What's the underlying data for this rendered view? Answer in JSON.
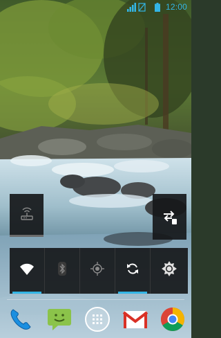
{
  "status_bar": {
    "time": "12:00",
    "accent_color": "#33b5e5",
    "icons": [
      "signal-icon",
      "battery-icon"
    ]
  },
  "widgets": {
    "left_tile": {
      "icon": "wifi-hotspot-icon",
      "active": false
    },
    "right_tile": {
      "icon": "data-transfer-icon",
      "active": false
    }
  },
  "power_control": {
    "toggles": [
      {
        "icon": "wifi-icon",
        "active": true
      },
      {
        "icon": "bluetooth-icon",
        "active": false
      },
      {
        "icon": "gps-icon",
        "active": false
      },
      {
        "icon": "sync-icon",
        "active": true
      },
      {
        "icon": "brightness-icon",
        "active": false
      }
    ],
    "on_color": "#33b5e5"
  },
  "dock": {
    "apps": [
      "phone-icon",
      "messaging-icon",
      "app-drawer-icon",
      "gmail-icon",
      "chrome-icon"
    ]
  }
}
